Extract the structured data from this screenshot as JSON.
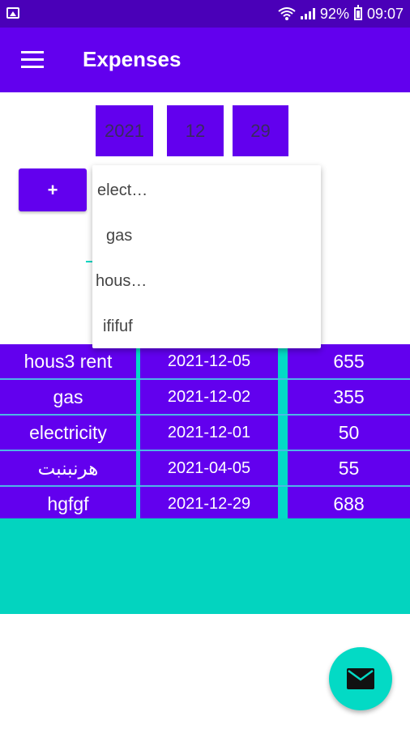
{
  "status_bar": {
    "battery": "92%",
    "time": "09:07"
  },
  "app_bar": {
    "title": "Expenses"
  },
  "date_fields": {
    "year": "2021",
    "month": "12",
    "day": "29"
  },
  "add_button_label": "+",
  "dropdown": {
    "options": [
      "elect…",
      "gas",
      "hous…",
      "ififuf"
    ]
  },
  "table": {
    "rows": [
      {
        "name": "hous3 rent",
        "date": "2021-12-05",
        "amount": "655"
      },
      {
        "name": "gas",
        "date": "2021-12-02",
        "amount": "355"
      },
      {
        "name": "electricity",
        "date": "2021-12-01",
        "amount": "50"
      },
      {
        "name": "هرنبنبت",
        "date": "2021-04-05",
        "amount": "55"
      },
      {
        "name": "hgfgf",
        "date": "2021-12-29",
        "amount": "688"
      }
    ]
  },
  "fab": {
    "icon": "mail-icon"
  }
}
